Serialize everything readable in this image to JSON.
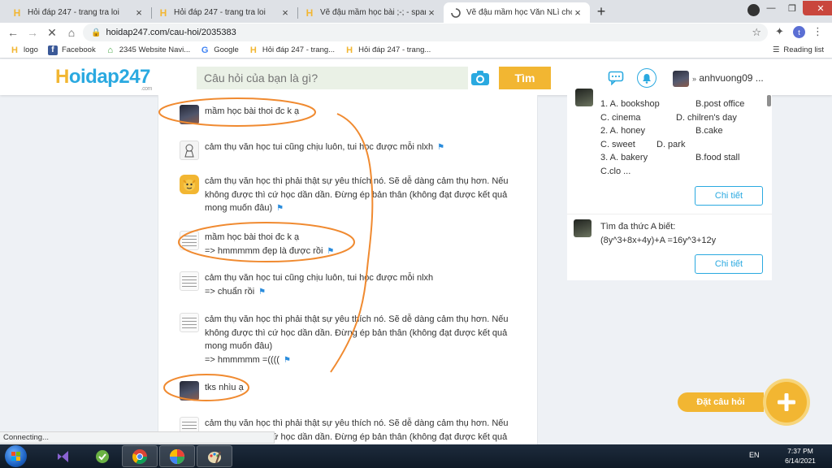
{
  "browser": {
    "tabs": [
      {
        "title": "Hỏi đáp 247 - trang tra loi"
      },
      {
        "title": "Hỏi đáp 247 - trang tra loi"
      },
      {
        "title": "Vẽ đậu mầm học bài ;-; - spam ;-;"
      },
      {
        "title": "Vẽ đậu mầm học Văn NLì cho em"
      }
    ],
    "url": "hoidap247.com/cau-hoi/2035383",
    "profile_initial": "t",
    "bookmarks": [
      {
        "label": "logo",
        "icon": "h-logo-icon"
      },
      {
        "label": "Facebook",
        "icon": "facebook-icon"
      },
      {
        "label": "2345 Website Navi...",
        "icon": "2345-icon"
      },
      {
        "label": "Google",
        "icon": "google-icon"
      },
      {
        "label": "Hỏi đáp 247 - trang...",
        "icon": "h-logo-icon"
      },
      {
        "label": "Hỏi đáp 247 - trang...",
        "icon": "h-logo-icon"
      }
    ],
    "reading_list": "Reading list",
    "status": "Connecting..."
  },
  "site": {
    "logo": {
      "first": "H",
      "rest": "oidap247",
      "suffix": ".com"
    },
    "search_placeholder": "Câu hỏi của bạn là gì?",
    "search_button": "Tìm",
    "username": "anhvuong09 ...",
    "colors": {
      "brand_blue": "#2aa9e0",
      "brand_yellow": "#f2b632",
      "annotation_orange": "#f08a30"
    }
  },
  "comments": [
    {
      "lines": [
        "mầm học bài thoi đc k ạ"
      ],
      "flag": false,
      "avatar": "dark"
    },
    {
      "lines": [
        "cảm thụ văn học tui cũng chịu luôn, tui học được mỗi nlxh"
      ],
      "flag": true,
      "avatar": "cartoon"
    },
    {
      "lines": [
        "cảm thụ văn học thì phải thật sự yêu thích nó. Sẽ dễ dàng cảm thụ hơn. Nếu",
        "không được thì cứ học dần dần. Đừng ép bản thân (không đạt được kết quả",
        "mong muốn đâu)"
      ],
      "flag": true,
      "avatar": "yellow"
    },
    {
      "lines": [
        "mầm học bài thoi đc k ạ",
        "=> hmmmmm đẹp là được rồi"
      ],
      "flag": true,
      "avatar": "doc"
    },
    {
      "lines": [
        "cảm thụ văn học tui cũng chịu luôn, tui học được mỗi nlxh",
        "=> chuẩn rồi"
      ],
      "flag": true,
      "avatar": "doc"
    },
    {
      "lines": [
        "cảm thụ văn học thì phải thật sự yêu thích nó. Sẽ dễ dàng cảm thụ hơn. Nếu",
        "không được thì cứ học dần dần. Đừng ép bản thân (không đạt được kết quả",
        "mong muốn đâu)",
        "=> hmmmmm =(((("
      ],
      "flag": true,
      "avatar": "doc"
    },
    {
      "lines": [
        "tks nhìu ạ"
      ],
      "flag": false,
      "avatar": "dark"
    },
    {
      "lines": [
        "cảm thụ văn học thì phải thật sự yêu thích nó. Sẽ dễ dàng cảm thụ hơn. Nếu",
        "không được thì cứ học dần dần. Đừng ép bản thân (không đạt được kết quả"
      ],
      "flag": false,
      "avatar": "doc"
    }
  ],
  "sidebar": {
    "q1": {
      "rows": [
        [
          "1. A. bookshop",
          "B.post office"
        ],
        [
          "C. cinema",
          "D. chilren's day"
        ],
        [
          "2. A. honey",
          "B.cake"
        ],
        [
          "C. sweet",
          "D. park"
        ],
        [
          "3. A. bakery",
          "B.food stall"
        ],
        [
          "C.clo ...",
          ""
        ]
      ],
      "button": "Chi tiết"
    },
    "q2": {
      "lines": [
        "Tìm đa thức A biết:",
        "(8y^3+8x+4y)+A =16y^3+12y"
      ],
      "button": "Chi tiết"
    }
  },
  "ask": {
    "label": "Đặt câu hỏi"
  },
  "taskbar": {
    "lang": "EN",
    "time": "7:37 PM",
    "date": "6/14/2021"
  }
}
